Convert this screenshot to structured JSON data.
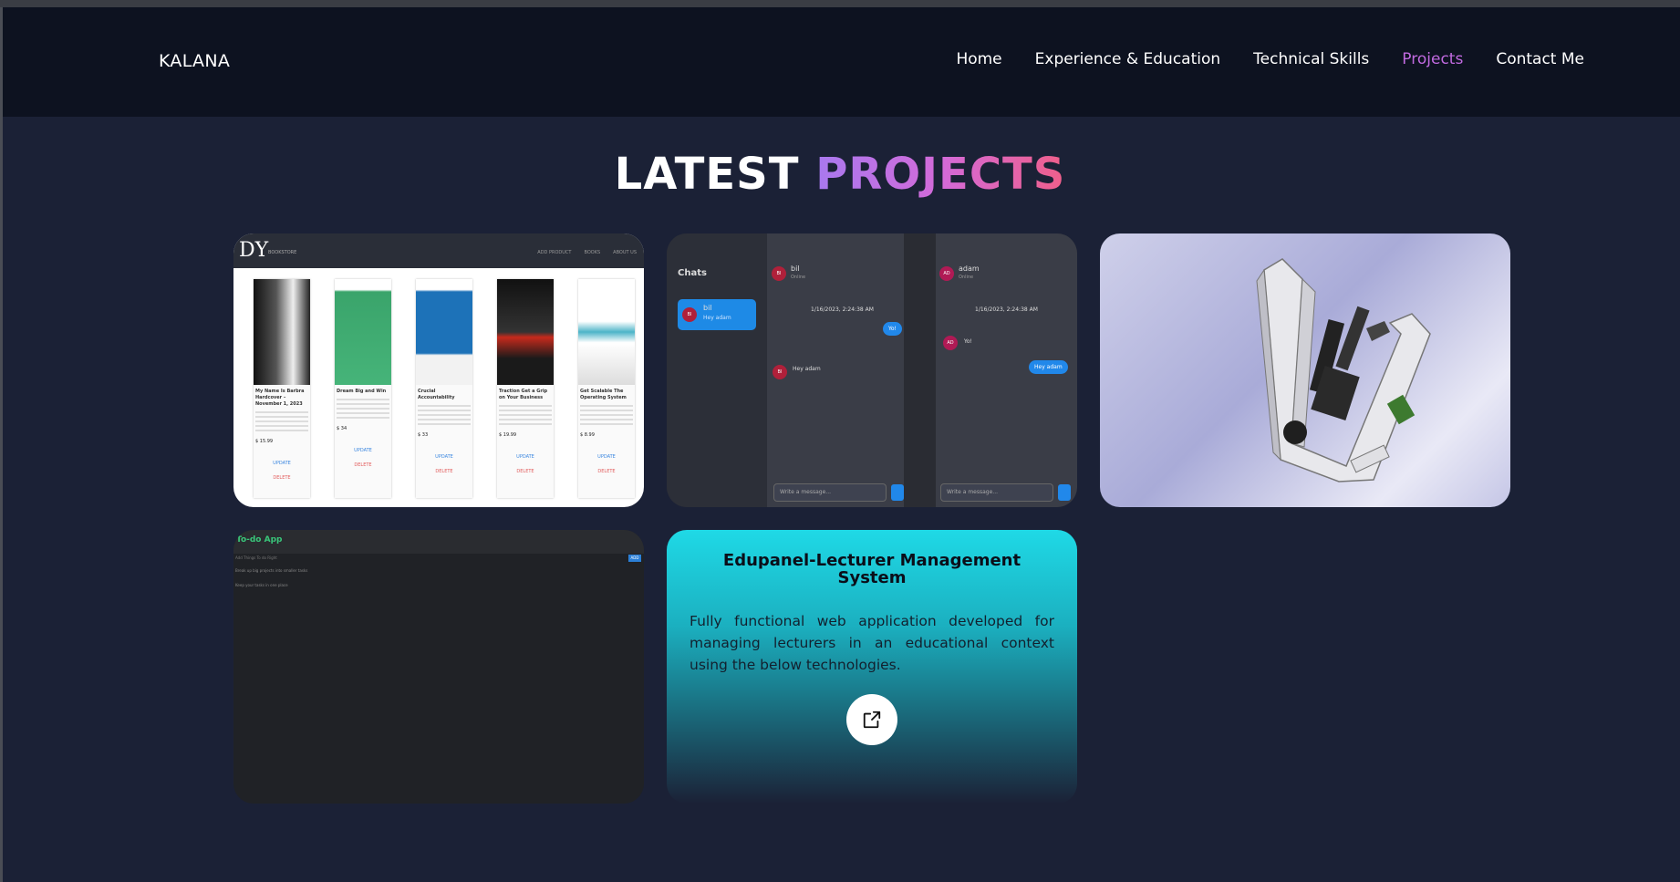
{
  "nav": {
    "brand": "KALANA",
    "items": [
      {
        "label": "Home",
        "active": false
      },
      {
        "label": "Experience & Education",
        "active": false
      },
      {
        "label": "Technical Skills",
        "active": false
      },
      {
        "label": "Projects",
        "active": true
      },
      {
        "label": "Contact Me",
        "active": false
      }
    ]
  },
  "section": {
    "title_part1": "LATEST",
    "title_part2": "PROJECTS"
  },
  "projects": {
    "bookstore": {
      "logo": "DY",
      "logo_sub": "BOOKSTORE",
      "nav": [
        "ADD PRODUCT",
        "BOOKS",
        "ABOUT US"
      ],
      "books": [
        {
          "title": "My Name Is Barbra Hardcover – November 1, 2023",
          "price": "$ 15.99"
        },
        {
          "title": "Dream Big and Win",
          "price": "$ 34"
        },
        {
          "title": "Crucial Accountability",
          "price": "$ 33"
        },
        {
          "title": "Traction Get a Grip on Your Business",
          "price": "$ 19.99"
        },
        {
          "title": "Get Scalable The Operating System",
          "price": "$ 8.99"
        }
      ],
      "update": "UPDATE",
      "delete": "DELETE"
    },
    "chat": {
      "chats_label": "Chats",
      "contact1": "bil",
      "contact1_preview": "Hey adam",
      "contact2": "adam",
      "status": "Online",
      "timestamp": "1/16/2023, 2:24:38 AM",
      "msg_hi": "Yo!",
      "msg_hey": "Hey adam",
      "input_placeholder": "Write a message..."
    },
    "todo": {
      "title": "To-do App",
      "input_placeholder": "Add Things To do Right",
      "add_label": "ADD",
      "items": [
        "Break up big projects into smaller tasks",
        "Keep your tasks in one place"
      ]
    },
    "featured": {
      "title": "Edupanel-Lecturer Management System",
      "description": "Fully functional web application developed for managing lecturers in an educational context using the below technologies.",
      "link_icon": "external-link-icon"
    }
  }
}
